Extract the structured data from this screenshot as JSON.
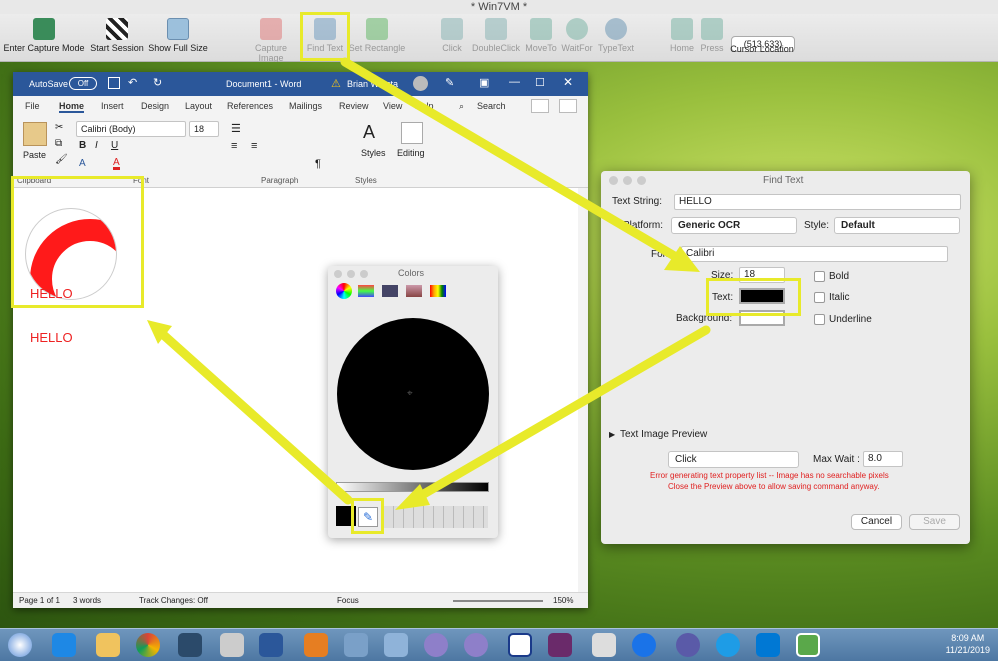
{
  "window_title": "* Win7VM *",
  "toolbar": {
    "items": [
      {
        "label": "Enter Capture Mode",
        "icon": "capture-mode-icon",
        "dim": false
      },
      {
        "label": "Start Session",
        "icon": "checkered-flag-icon",
        "dim": false
      },
      {
        "label": "Show Full Size",
        "icon": "resize-icon",
        "dim": false
      },
      {
        "label": "Capture Image",
        "icon": "camera-icon",
        "dim": true
      },
      {
        "label": "Find Text",
        "icon": "binoculars-icon",
        "dim": true
      },
      {
        "label": "Set Rectangle",
        "icon": "rectangle-icon",
        "dim": true
      },
      {
        "label": "Click",
        "icon": "click-icon",
        "dim": true
      },
      {
        "label": "DoubleClick",
        "icon": "double-click-icon",
        "dim": true
      },
      {
        "label": "MoveTo",
        "icon": "move-to-icon",
        "dim": true
      },
      {
        "label": "WaitFor",
        "icon": "wait-for-icon",
        "dim": true
      },
      {
        "label": "TypeText",
        "icon": "type-text-icon",
        "dim": true
      },
      {
        "label": "Home",
        "icon": "home-icon",
        "dim": true
      },
      {
        "label": "Press",
        "icon": "press-icon",
        "dim": true
      },
      {
        "label": "Cursor Location",
        "icon": "cursor-location-icon",
        "dim": false
      }
    ],
    "cursor_coords": "(513,633)"
  },
  "word": {
    "autosave_label": "AutoSave",
    "autosave_state": "Off",
    "doc_title": "Document1 - Word",
    "user": "Brian Winsta",
    "tabs": [
      "File",
      "Home",
      "Insert",
      "Design",
      "Layout",
      "References",
      "Mailings",
      "Review",
      "View",
      "Help"
    ],
    "search_label": "Search",
    "font_name": "Calibri (Body)",
    "font_size": "18",
    "groups": {
      "clipboard": "Clipboard",
      "font": "Font",
      "paragraph": "Paragraph",
      "styles": "Styles",
      "editing": "Editing",
      "paste": "Paste"
    },
    "doc_text_1": "HELLO",
    "doc_text_2": "HELLO",
    "status": {
      "page": "Page 1 of 1",
      "words": "3 words",
      "track": "Track Changes: Off",
      "focus": "Focus",
      "zoom": "150%"
    }
  },
  "colors_panel": {
    "title": "Colors"
  },
  "find_text": {
    "title": "Find Text",
    "text_string_label": "Text String:",
    "text_string_value": "HELLO",
    "platform_label": "Platform:",
    "platform_value": "Generic OCR",
    "style_label": "Style:",
    "style_value": "Default",
    "font_label": "Font:",
    "font_value": "Calibri",
    "size_label": "Size:",
    "size_value": "18",
    "text_label": "Text:",
    "background_label": "Background:",
    "bold_label": "Bold",
    "italic_label": "Italic",
    "underline_label": "Underline",
    "preview_label": "Text Image Preview",
    "action_value": "Click",
    "max_wait_label": "Max Wait :",
    "max_wait_value": "8.0",
    "error_line_1": "Error generating text property list -- Image has no searchable pixels",
    "error_line_2": "Close the Preview above to allow saving command anyway.",
    "cancel_label": "Cancel",
    "save_label": "Save",
    "text_color": "#000000",
    "bg_color": "#ffffff",
    "error_color": "#e02020"
  },
  "taskbar": {
    "clock_time": "8:09 AM",
    "clock_date": "11/21/2019"
  }
}
